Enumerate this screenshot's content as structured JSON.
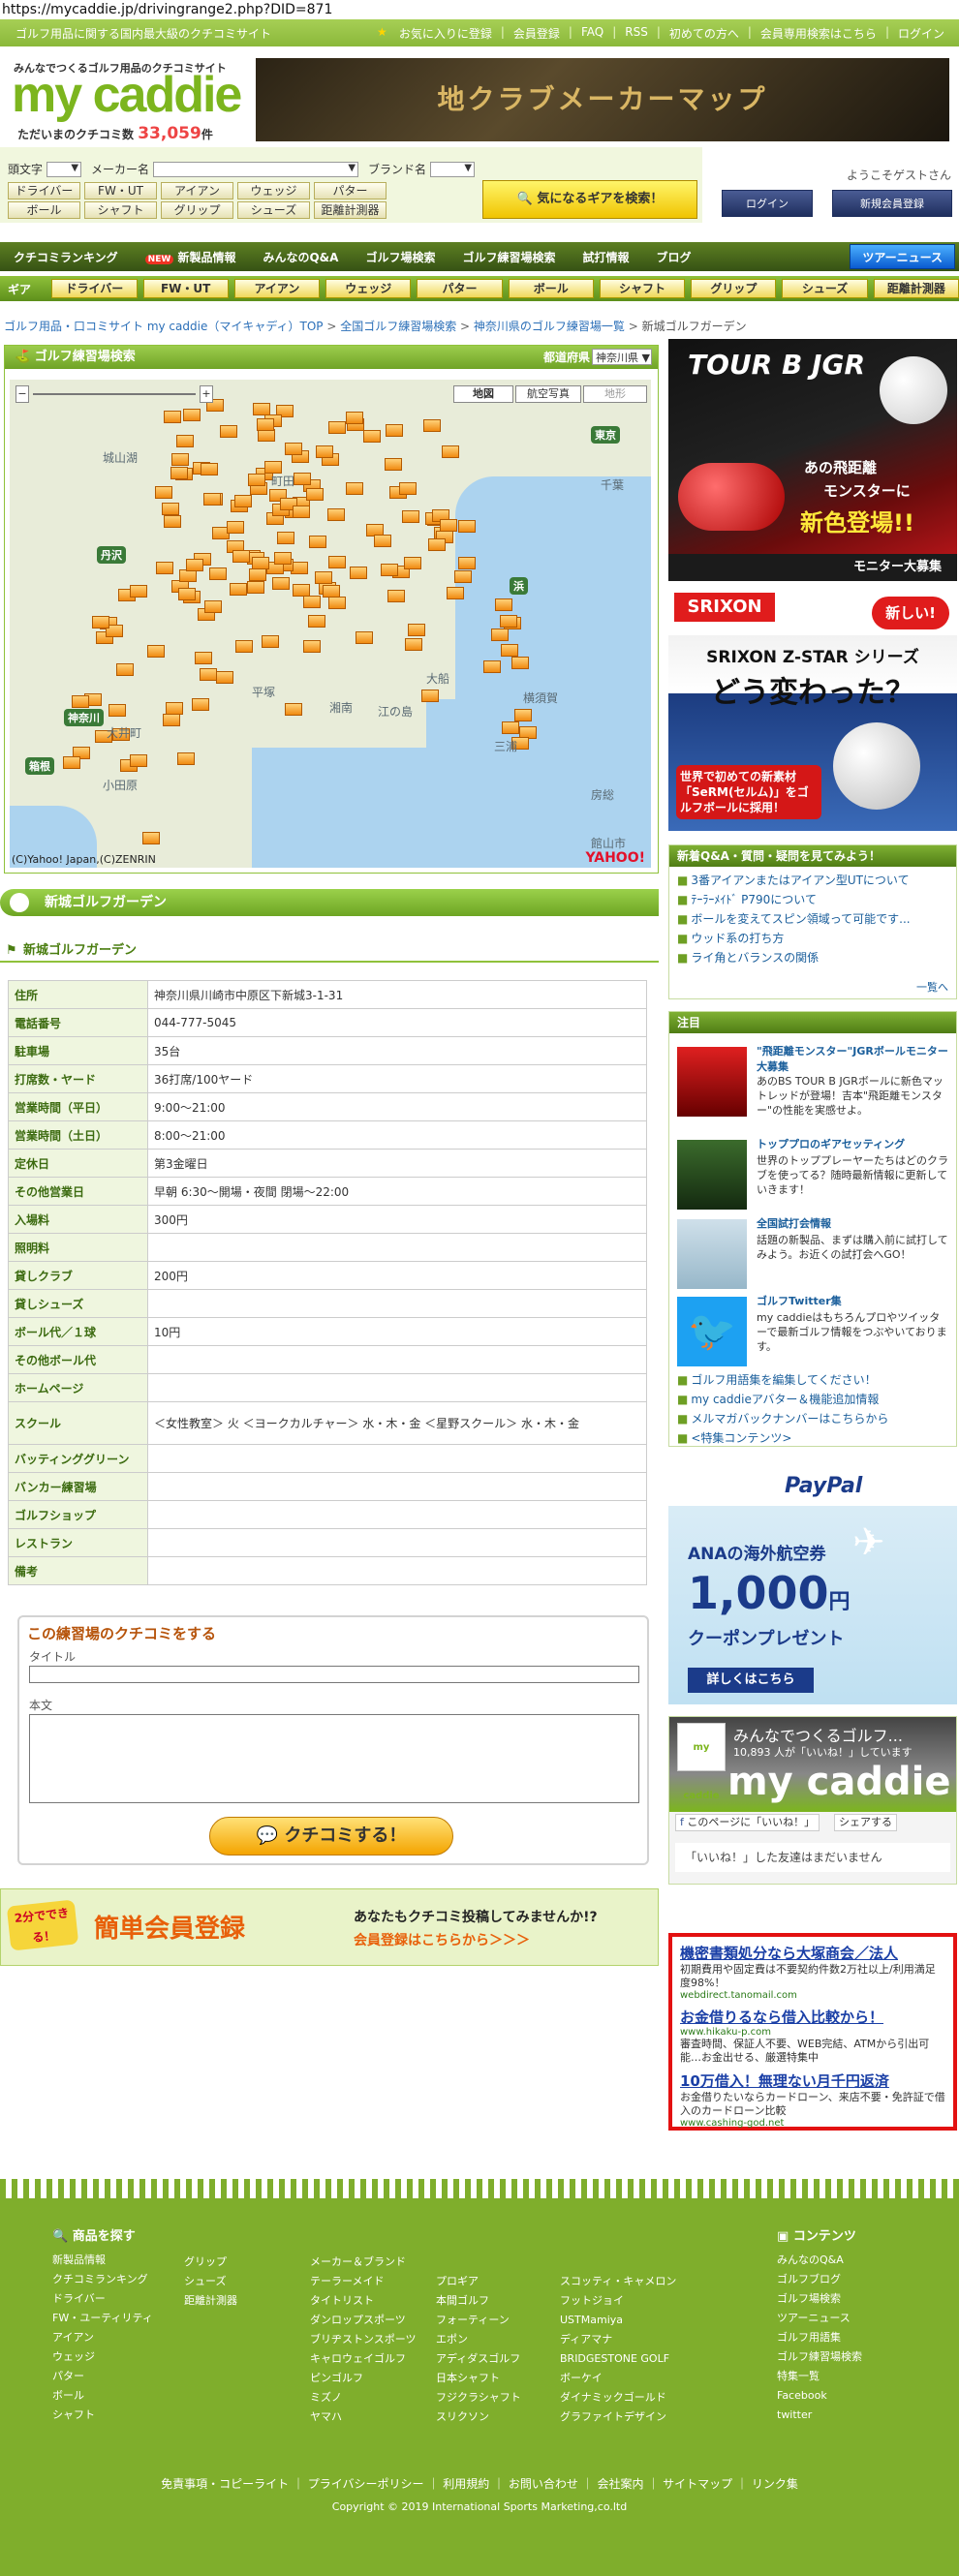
{
  "url": "https://mycaddie.jp/drivingrange2.php?DID=871",
  "topbar": {
    "tagline": "ゴルフ用品に関する国内最大級のクチコミサイト",
    "links": [
      "お気に入りに登録",
      "会員登録",
      "FAQ",
      "RSS",
      "初めての方へ",
      "会員専用検索はこちら",
      "ログイン"
    ]
  },
  "logo": {
    "subtitle": "みんなでつくるゴルフ用品のクチコミサイト",
    "name": "my caddie",
    "count_prefix": "ただいまのクチコミ数",
    "count": "33,059",
    "count_suffix": "件"
  },
  "top_banner": "地クラブメーカーマップ",
  "search": {
    "initial_label": "頭文字",
    "maker_label": "メーカー名",
    "brand_label": "ブランド名",
    "row1": [
      "ドライバー",
      "FW・UT",
      "アイアン",
      "ウェッジ",
      "パター"
    ],
    "row2": [
      "ボール",
      "シャフト",
      "グリップ",
      "シューズ",
      "距離計測器"
    ],
    "button": "気になるギアを検索！"
  },
  "user": {
    "welcome": "ようこそゲストさん",
    "login": "ログイン",
    "register": "新規会員登録"
  },
  "nav": [
    "クチコミランキング",
    "新製品情報",
    "みんなのQ&A",
    "ゴルフ場検索",
    "ゴルフ練習場検索",
    "試打情報",
    "ブログ",
    "ツアーニュース"
  ],
  "nav_new_badge": "NEW",
  "gearbar": {
    "label": "ギア",
    "items": [
      "ドライバー",
      "FW・UT",
      "アイアン",
      "ウェッジ",
      "パター",
      "ボール",
      "シャフト",
      "グリップ",
      "シューズ",
      "距離計測器"
    ]
  },
  "breadcrumb": [
    "ゴルフ用品・口コミサイト my caddie（マイキャディ）TOP",
    "全国ゴルフ練習場検索",
    "神奈川県のゴルフ練習場一覧",
    "新城ゴルフガーデン"
  ],
  "map": {
    "title": "ゴルフ練習場検索",
    "pref_label": "都道府県",
    "pref_value": "神奈川県",
    "modes": [
      "地図",
      "航空写真",
      "地形"
    ],
    "labels": [
      "東京",
      "丹沢",
      "神奈川",
      "箱根",
      "平塚",
      "湘南",
      "江の島",
      "横須賀",
      "三浦",
      "房総",
      "大船",
      "小田原",
      "大井町",
      "町田",
      "浜",
      "城山湖",
      "千葉",
      "館山市"
    ],
    "copyright": "(C)Yahoo! Japan,(C)ZENRIN",
    "yahoo": "YAHOO!"
  },
  "range": {
    "name": "新城ゴルフガーデン",
    "fields": [
      {
        "k": "住所",
        "v": "神奈川県川崎市中原区下新城3-1-31"
      },
      {
        "k": "電話番号",
        "v": "044-777-5045"
      },
      {
        "k": "駐車場",
        "v": "35台"
      },
      {
        "k": "打席数・ヤード",
        "v": "36打席/100ヤード"
      },
      {
        "k": "営業時間（平日）",
        "v": "9:00～21:00"
      },
      {
        "k": "営業時間（土日）",
        "v": "8:00～21:00"
      },
      {
        "k": "定休日",
        "v": "第3金曜日"
      },
      {
        "k": "その他営業日",
        "v": "早朝 6:30～開場・夜間 閉場～22:00"
      },
      {
        "k": "入場料",
        "v": "300円"
      },
      {
        "k": "照明料",
        "v": ""
      },
      {
        "k": "貸しクラブ",
        "v": "200円"
      },
      {
        "k": "貸しシューズ",
        "v": ""
      },
      {
        "k": "ボール代／１球",
        "v": "10円"
      },
      {
        "k": "その他ボール代",
        "v": ""
      },
      {
        "k": "ホームページ",
        "v": ""
      },
      {
        "k": "スクール",
        "v": "＜女性教室＞ 火 ＜ヨークカルチャー＞ 水・木・金 ＜星野スクール＞ 水・木・金"
      },
      {
        "k": "バッティンググリーン",
        "v": ""
      },
      {
        "k": "バンカー練習場",
        "v": ""
      },
      {
        "k": "ゴルフショップ",
        "v": ""
      },
      {
        "k": "レストラン",
        "v": ""
      },
      {
        "k": "備考",
        "v": ""
      }
    ]
  },
  "review": {
    "heading": "この練習場のクチコミをする",
    "title_label": "タイトル",
    "body_label": "本文",
    "submit": "クチコミする！"
  },
  "register_banner": {
    "badge": "2分でできる！",
    "title": "簡単会員登録",
    "line1": "あなたもクチコミ投稿してみませんか!?",
    "line2": "会員登録はこちらから＞＞＞"
  },
  "side_ads": {
    "ad1_brand": "TOUR B JGR",
    "ad1_line1": "あの飛距離",
    "ad1_line2": "モンスターに",
    "ad1_line3": "新色登場!!",
    "ad1_button": "モニター大募集",
    "ad2_brand": "SRIXON",
    "ad2_new": "新しい!",
    "ad2_line1": "SRIXON Z-STAR シリーズ",
    "ad2_line2": "どう変わった？",
    "ad2_line3": "世界で初めての新素材「SeRM(セルム)」をゴルフボールに採用！"
  },
  "qa": {
    "head": "新着Q&A・質問・疑問を見てみよう！",
    "items": [
      "3番アイアンまたはアイアン型UTについて",
      "ﾃｰﾗｰﾒｲﾄﾞ P790について",
      "ボールを変えてスピン領域って可能です...",
      "ウッド系の打ち方",
      "ライ角とバランスの関係"
    ],
    "more": "一覧へ"
  },
  "featured": {
    "head": "注目",
    "items": [
      {
        "t": "\"飛距離モンスター\"JGRボールモニター大募集",
        "d": "あのBS TOUR B JGRボールに新色マットレッドが登場！吉本\"飛距離モンスター\"の性能を実感せよ。"
      },
      {
        "t": "トッププロのギアセッティング",
        "d": "世界のトッププレーヤーたちはどのクラブを使ってる？随時最新情報に更新していきます！"
      },
      {
        "t": "全国試打会情報",
        "d": "話題の新製品、まずは購入前に試打してみよう。お近くの試打会へGO！"
      },
      {
        "t": "ゴルフTwitter集",
        "d": "my caddieはもちろんプロやツイッターで最新ゴルフ情報をつぶやいております。"
      }
    ],
    "links": [
      "ゴルフ用語集を編集してください！",
      "my caddieアバター＆機能追加情報",
      "メルマガバックナンバーはこちらから",
      "<特集コンテンツ>"
    ]
  },
  "anaad": {
    "brand": "PayPal",
    "line1": "ANAの海外航空券",
    "amount": "1,000",
    "unit": "円",
    "line2": "クーポンプレゼント",
    "cta": "詳しくはこちら"
  },
  "fb": {
    "title": "みんなでつくるゴルフ...",
    "likes": "10,893 人が「いいね！」しています",
    "logo": "my caddie",
    "like_btn": "このページに「いいね！」",
    "share": "シェアする",
    "empty": "「いいね！」した友達はまだいません"
  },
  "textads": [
    {
      "t": "機密書類処分なら大塚商会／法人",
      "u": "webdirect.tanomail.com",
      "d": "初期費用や固定費は不要契約件数2万社以上/利用満足度98%！"
    },
    {
      "t": "お金借りるなら借入比較から！",
      "u": "www.hikaku-p.com",
      "d": "審査時間、保証人不要、WEB完結、ATMから引出可能…お金出せる、厳選特集中"
    },
    {
      "t": "10万借入！無理ない月千円返済",
      "u": "www.cashing-god.net",
      "d": "お金借りたいならカードローン、来店不要・免許証で借入のカードローン比較"
    }
  ],
  "footer": {
    "search_head": "商品を探す",
    "col1": [
      "新製品情報",
      "クチコミランキング",
      "ドライバー",
      "FW・ユーティリティ",
      "アイアン",
      "ウェッジ",
      "パター",
      "ボール",
      "シャフト"
    ],
    "col2": [
      "グリップ",
      "シューズ",
      "距離計測器"
    ],
    "col3_head": "メーカー＆ブランド",
    "col3": [
      "テーラーメイド",
      "タイトリスト",
      "ダンロップスポーツ",
      "ブリヂストンスポーツ",
      "キャロウェイゴルフ",
      "ピンゴルフ",
      "ミズノ",
      "ヤマハ"
    ],
    "col4": [
      "プロギア",
      "本間ゴルフ",
      "フォーティーン",
      "エポン",
      "アディダスゴルフ",
      "日本シャフト",
      "フジクラシャフト",
      "スリクソン"
    ],
    "col5": [
      "スコッティ・キャメロン",
      "フットジョイ",
      "USTMamiya",
      "ディアマナ",
      "BRIDGESTONE GOLF",
      "ボーケイ",
      "ダイナミックゴールド",
      "グラファイトデザイン"
    ],
    "contents_head": "コンテンツ",
    "col6": [
      "みんなのQ&A",
      "ゴルフブログ",
      "ゴルフ場検索",
      "ツアーニュース",
      "ゴルフ用語集",
      "ゴルフ練習場検索",
      "特集一覧",
      "Facebook",
      "twitter"
    ],
    "bottom_links": [
      "免責事項・コピーライト",
      "プライバシーポリシー",
      "利用規約",
      "お問い合わせ",
      "会社案内",
      "サイトマップ",
      "リンク集"
    ],
    "copyright": "Copyright © 2019 International Sports Marketing,co.ltd"
  }
}
